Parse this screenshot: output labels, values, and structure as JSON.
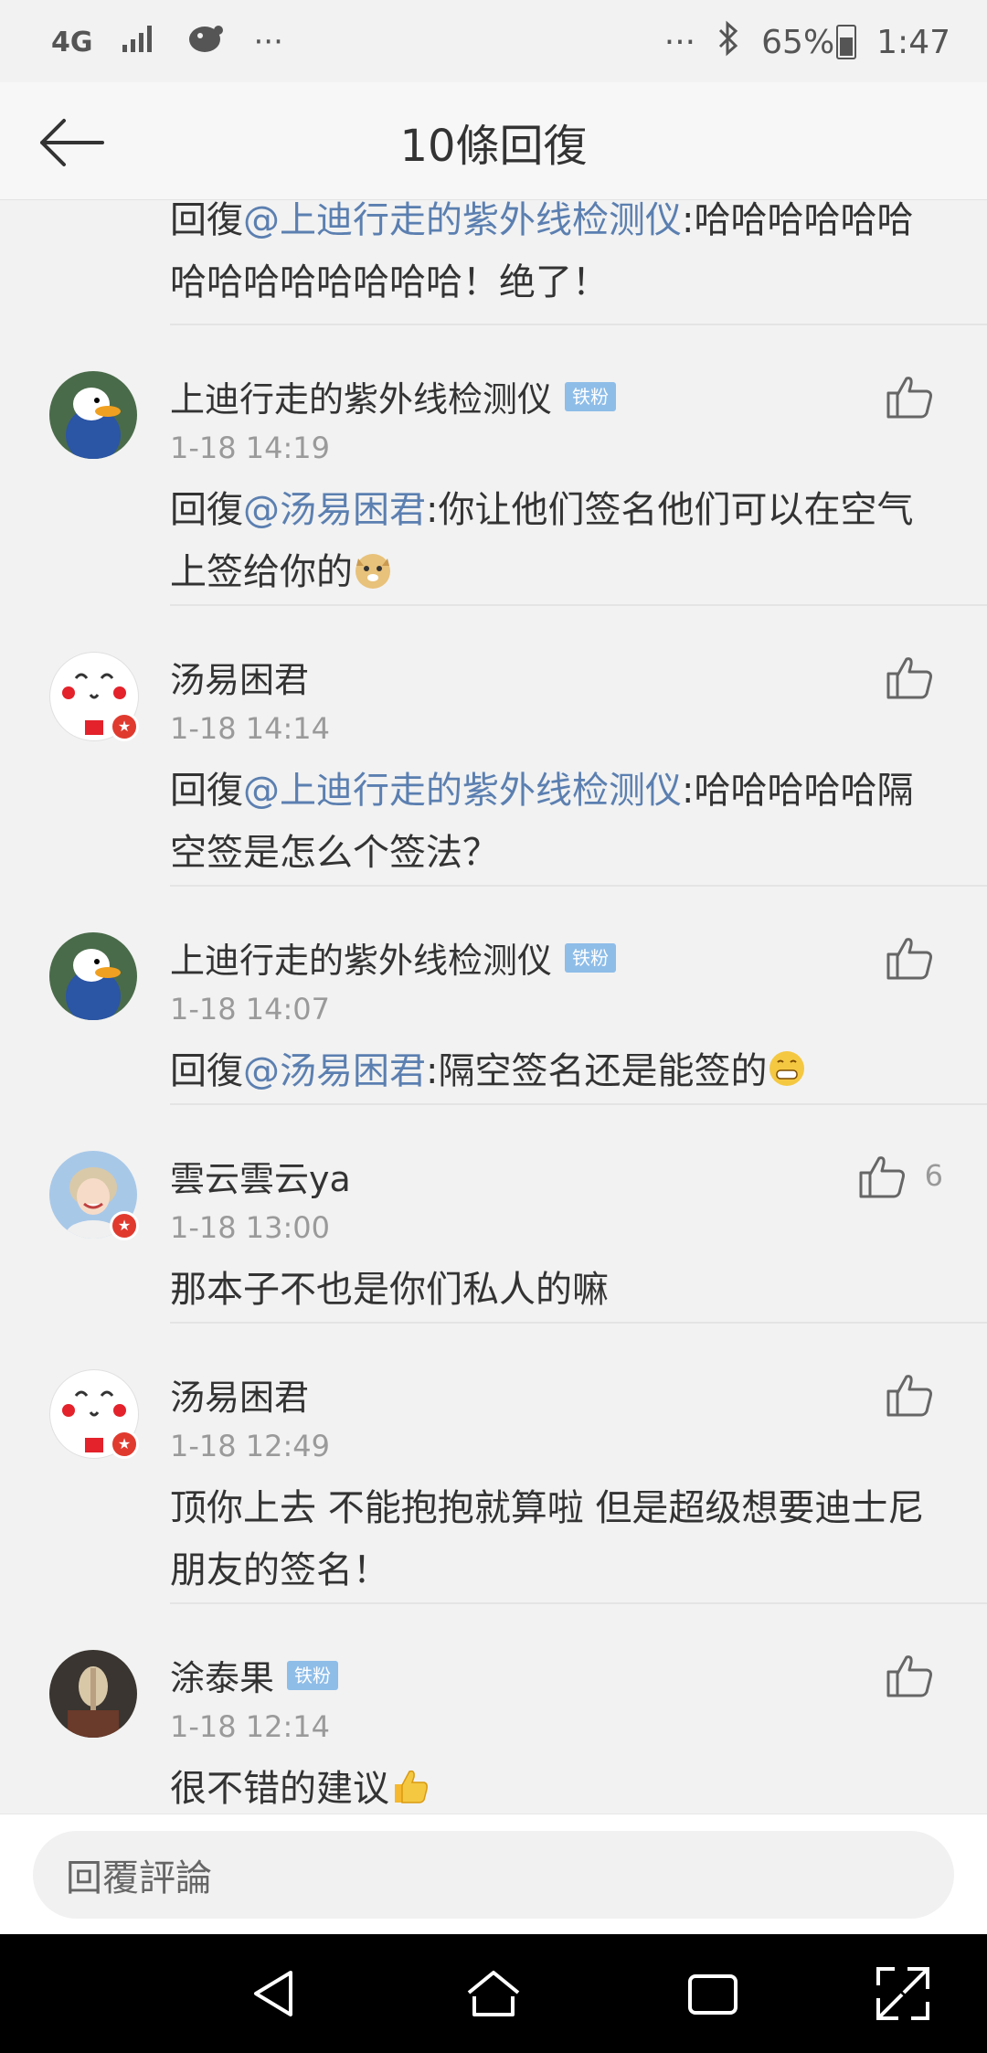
{
  "status_bar": {
    "network": "4G",
    "more_left": "···",
    "more_right": "···",
    "battery": "65%",
    "time": "1:47"
  },
  "header": {
    "title": "10條回復"
  },
  "top_fragment": {
    "prefix": "回復",
    "mention": "@上迪行走的紫外线检测仪",
    "text": ":哈哈哈哈哈哈哈哈哈哈哈哈哈哈！绝了！"
  },
  "comments": [
    {
      "name": "上迪行走的紫外线检测仪",
      "badge": "铁粉",
      "time": "1-18 14:19",
      "prefix": "回復",
      "mention": "@汤易困君",
      "text": ":你让他们签名他们可以在空气上签给你的",
      "emoji": "doge",
      "likes": ""
    },
    {
      "name": "汤易困君",
      "badge": "",
      "time": "1-18 14:14",
      "prefix": "回復",
      "mention": "@上迪行走的紫外线检测仪",
      "text": ":哈哈哈哈哈隔空签是怎么个签法？",
      "emoji": "",
      "likes": ""
    },
    {
      "name": "上迪行走的紫外线检测仪",
      "badge": "铁粉",
      "time": "1-18 14:07",
      "prefix": "回復",
      "mention": "@汤易困君",
      "text": ":隔空签名还是能签的",
      "emoji": "grin",
      "likes": ""
    },
    {
      "name": "雲云雲云ya",
      "badge": "",
      "time": "1-18 13:00",
      "prefix": "",
      "mention": "",
      "text": "那本子不也是你们私人的嘛",
      "emoji": "",
      "likes": "6"
    },
    {
      "name": "汤易困君",
      "badge": "",
      "time": "1-18 12:49",
      "prefix": "",
      "mention": "",
      "text": "顶你上去 不能抱抱就算啦 但是超级想要迪士尼朋友的签名！",
      "emoji": "",
      "likes": ""
    },
    {
      "name": "涂泰果",
      "badge": "铁粉",
      "time": "1-18 12:14",
      "prefix": "",
      "mention": "",
      "text": "很不错的建议",
      "emoji": "thumbs-up",
      "likes": ""
    }
  ],
  "reply_bar": {
    "placeholder": "回覆評論"
  },
  "colors": {
    "mention": "#5b7fb0",
    "fan_badge": "#8ebde8",
    "background": "#f2f2f2"
  }
}
